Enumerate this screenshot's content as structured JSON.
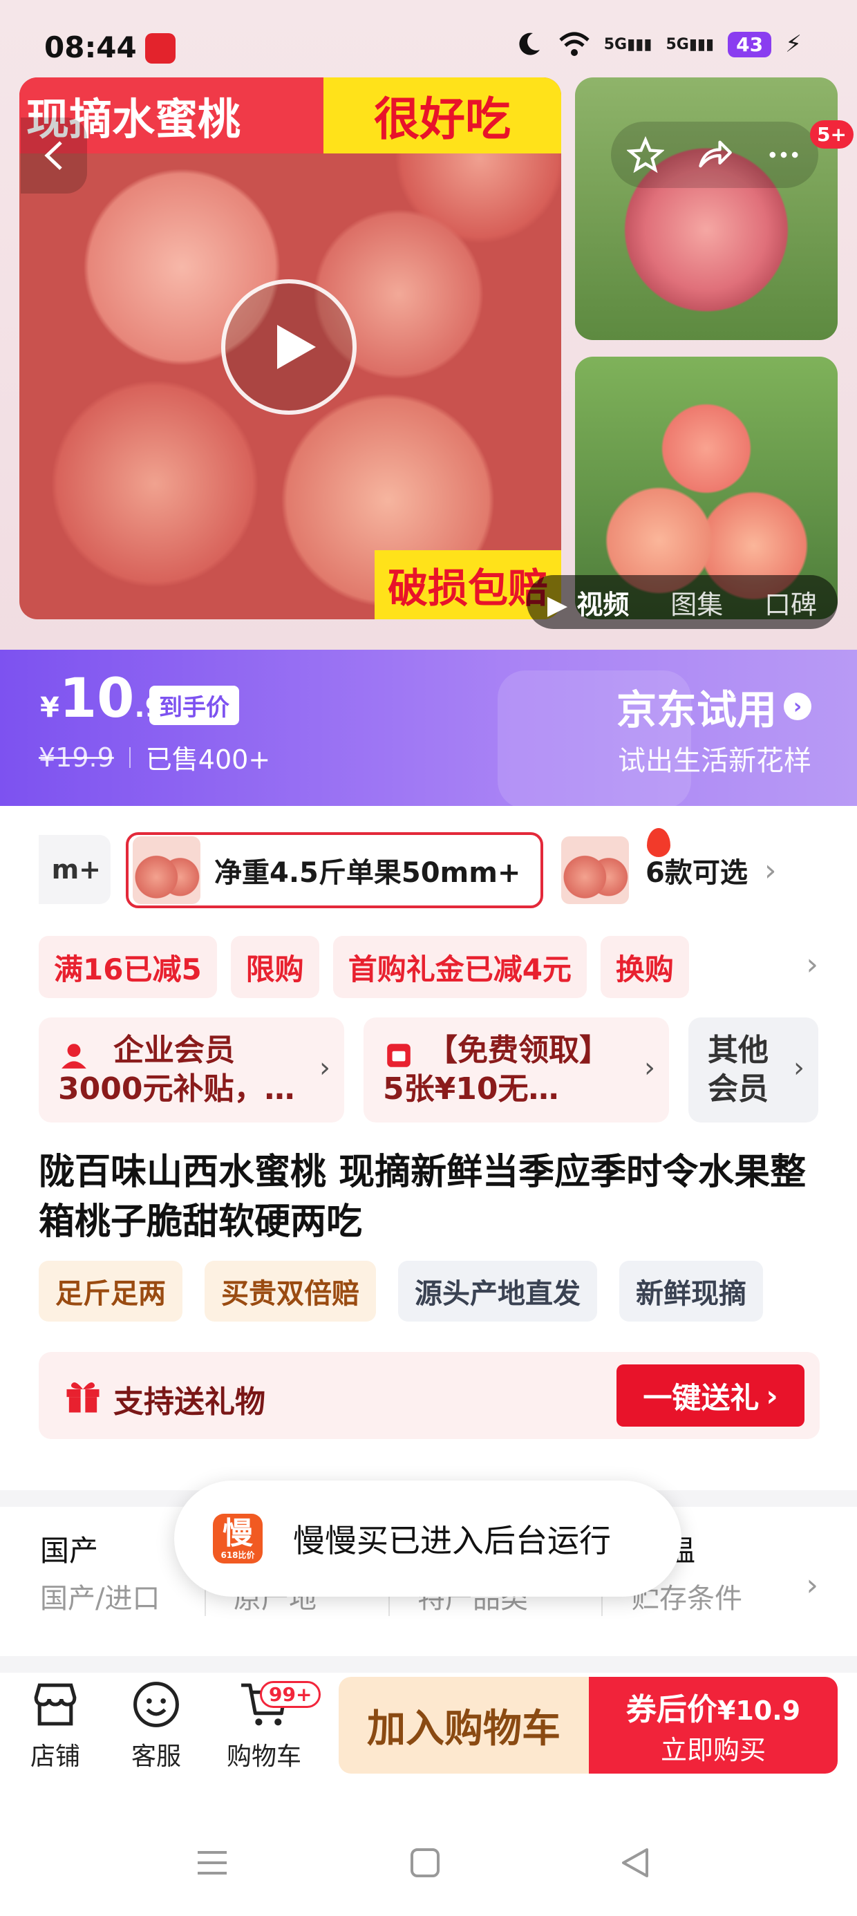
{
  "status_bar": {
    "time": "08:44",
    "signal_1": "5G",
    "signal_2": "5G",
    "battery": "43"
  },
  "gallery": {
    "banner_left": "现摘水蜜桃",
    "banner_right": "很好吃",
    "damage_tag": "破损包赔",
    "message_badge": "5+",
    "media_tabs": [
      {
        "label": "视频",
        "active": true
      },
      {
        "label": "图集",
        "active": false
      },
      {
        "label": "口碑",
        "active": false
      }
    ]
  },
  "price": {
    "currency": "¥",
    "integer": "10",
    "decimal": ".9",
    "final_tag": "到手价",
    "original": "¥19.9",
    "sold": "已售400+",
    "trial_title": "京东试用",
    "trial_subtitle": "试出生活新花样"
  },
  "specs": {
    "previous_partial": "m+",
    "selected": "净重4.5斤单果50mm+",
    "more": "6款可选"
  },
  "promotions": [
    "满16已减5",
    "限购",
    "首购礼金已减4元",
    "换购"
  ],
  "members": [
    {
      "text": "企业会员 3000元补贴，…"
    },
    {
      "text": "【免费领取】5张¥10无…"
    },
    {
      "text": "其他会员"
    }
  ],
  "product_title": "陇百味山西水蜜桃 现摘新鲜当季应季时令水果整箱桃子脆甜软硬两吃",
  "features": [
    {
      "label": "足斤足两",
      "style": "warm"
    },
    {
      "label": "买贵双倍赔",
      "style": "warm"
    },
    {
      "label": "源头产地直发",
      "style": "cool"
    },
    {
      "label": "新鲜现摘",
      "style": "cool"
    }
  ],
  "gift": {
    "label": "支持送礼物",
    "button": "一键送礼"
  },
  "attributes": [
    {
      "value": "国产",
      "label": "国产/进口"
    },
    {
      "value": "",
      "label": "原产地"
    },
    {
      "value": "",
      "label": "特产品类"
    },
    {
      "value": "温",
      "label": "贮存条件"
    }
  ],
  "toast": {
    "icon_char": "慢",
    "icon_sub": "618比价",
    "text": "慢慢买已进入后台运行"
  },
  "bottom_bar": {
    "store": "店铺",
    "service": "客服",
    "cart": "购物车",
    "cart_badge": "99+",
    "add_to_cart": "加入购物车",
    "buy_line1_prefix": "券后价",
    "buy_price": "¥10.9",
    "buy_line2": "立即购买"
  },
  "colors": {
    "accent_red": "#e8132a",
    "price_purple": "#7d52f0",
    "cart_beige": "#fde8cf"
  }
}
